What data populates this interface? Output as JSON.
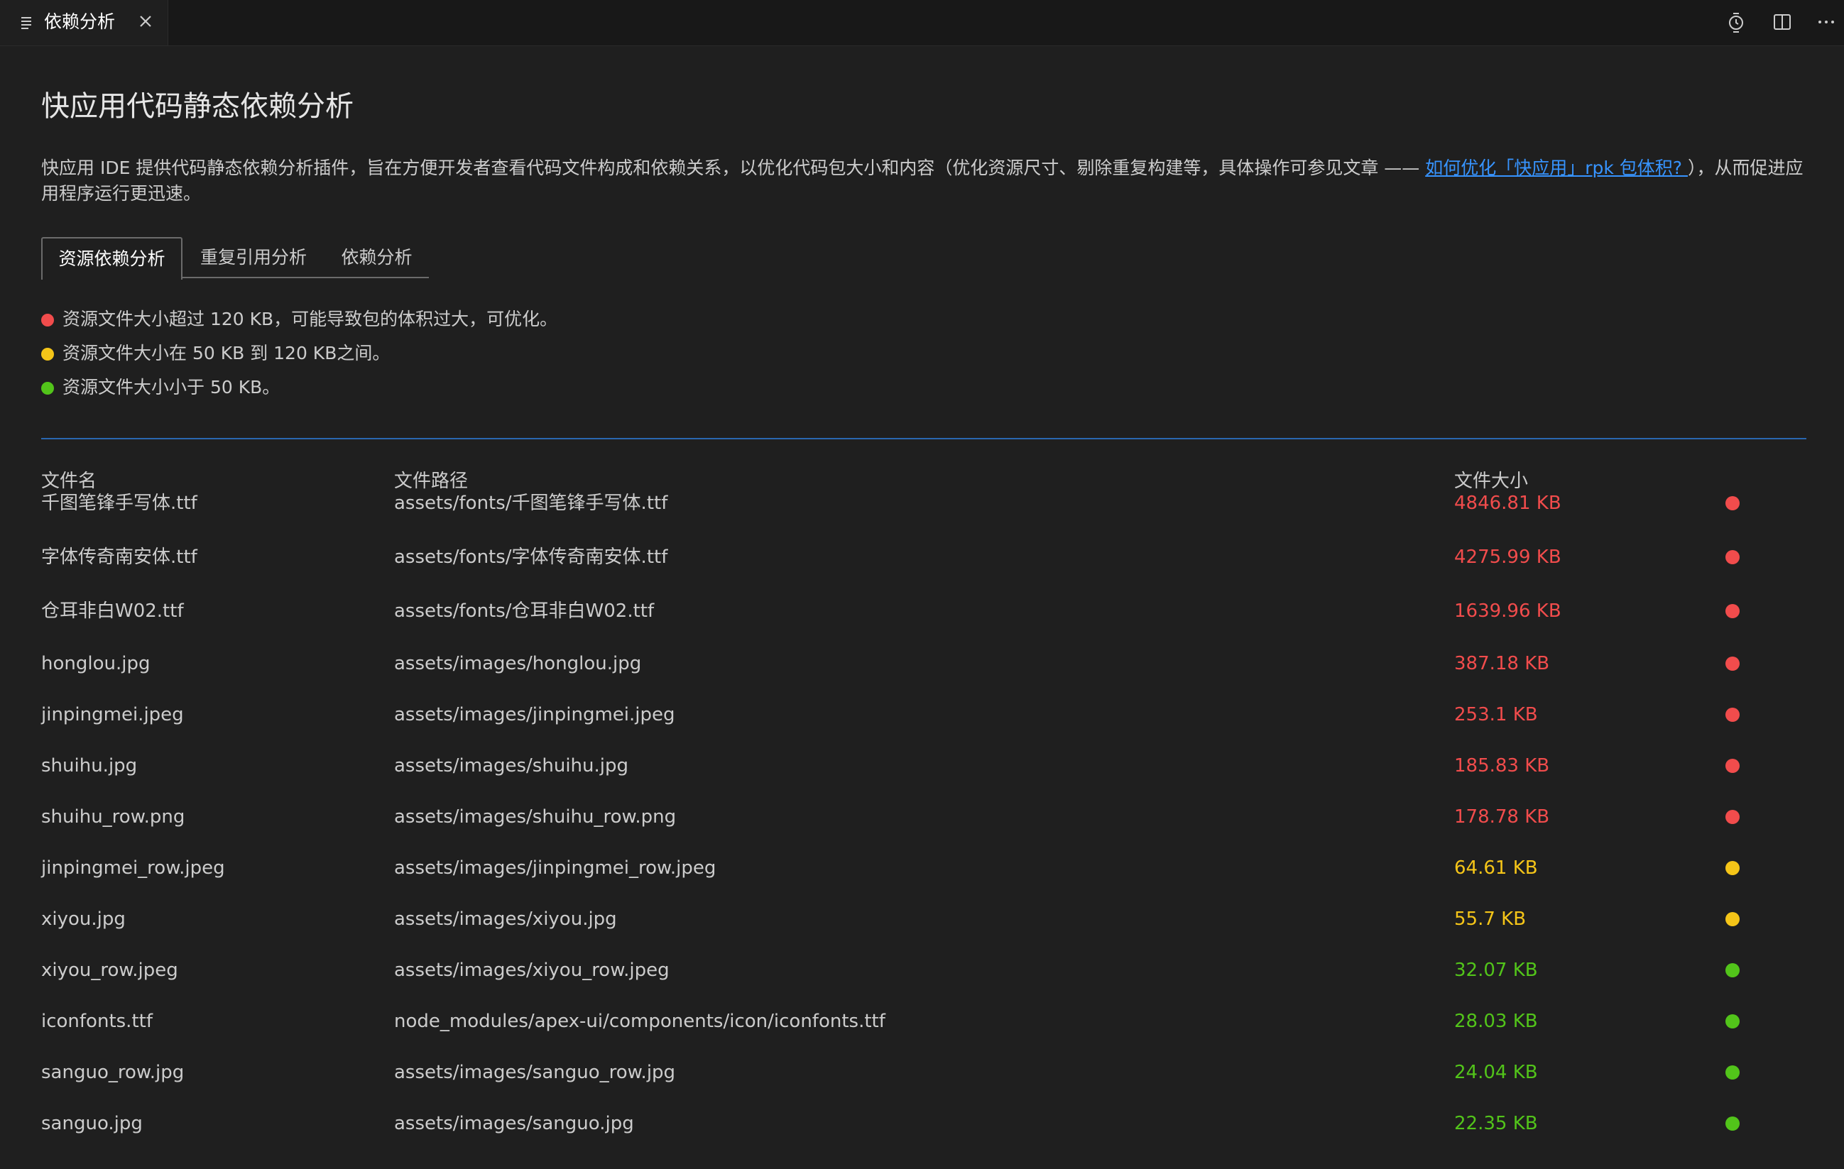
{
  "tab": {
    "title": "依赖分析"
  },
  "icons": {
    "tab": "list-icon",
    "close": "close-icon",
    "timeline": "timeline-icon",
    "split": "split-editor-icon",
    "more": "more-icon"
  },
  "colors": {
    "red": "#f14c4c",
    "yellow": "#f5c518",
    "green": "#52c41a",
    "link": "#3794ff",
    "red_text": "#f14c4c",
    "yellow_text": "#f5c518",
    "green_text": "#52c41a"
  },
  "page": {
    "title": "快应用代码静态依赖分析",
    "intro_text": "快应用 IDE 提供代码静态依赖分析插件，旨在方便开发者查看代码文件构成和依赖关系，以优化代码包大小和内容（优化资源尺寸、剔除重复构建等，具体操作可参见文章 —— ",
    "intro_link": "如何优化「快应用」rpk 包体积? ",
    "intro_tail": "），从而促进应用程序运行更迅速。"
  },
  "tabs": [
    "资源依赖分析",
    "重复引用分析",
    "依赖分析"
  ],
  "legend": [
    {
      "color": "red",
      "text": "资源文件大小超过 120 KB，可能导致包的体积过大，可优化。"
    },
    {
      "color": "yellow",
      "text": "资源文件大小在 50 KB 到 120 KB之间。"
    },
    {
      "color": "green",
      "text": "资源文件大小小于 50 KB。"
    }
  ],
  "table": {
    "headers": [
      "文件名",
      "文件路径",
      "文件大小"
    ],
    "rows": [
      {
        "name": "千图笔锋手写体.ttf",
        "path": "assets/fonts/千图笔锋手写体.ttf",
        "size": "4846.81 KB",
        "level": "red"
      },
      {
        "name": "字体传奇南安体.ttf",
        "path": "assets/fonts/字体传奇南安体.ttf",
        "size": "4275.99 KB",
        "level": "red"
      },
      {
        "name": "仓耳非白W02.ttf",
        "path": "assets/fonts/仓耳非白W02.ttf",
        "size": "1639.96 KB",
        "level": "red"
      },
      {
        "name": "honglou.jpg",
        "path": "assets/images/honglou.jpg",
        "size": "387.18 KB",
        "level": "red"
      },
      {
        "name": "jinpingmei.jpeg",
        "path": "assets/images/jinpingmei.jpeg",
        "size": "253.1 KB",
        "level": "red"
      },
      {
        "name": "shuihu.jpg",
        "path": "assets/images/shuihu.jpg",
        "size": "185.83 KB",
        "level": "red"
      },
      {
        "name": "shuihu_row.png",
        "path": "assets/images/shuihu_row.png",
        "size": "178.78 KB",
        "level": "red"
      },
      {
        "name": "jinpingmei_row.jpeg",
        "path": "assets/images/jinpingmei_row.jpeg",
        "size": "64.61 KB",
        "level": "yellow"
      },
      {
        "name": "xiyou.jpg",
        "path": "assets/images/xiyou.jpg",
        "size": "55.7 KB",
        "level": "yellow"
      },
      {
        "name": "xiyou_row.jpeg",
        "path": "assets/images/xiyou_row.jpeg",
        "size": "32.07 KB",
        "level": "green"
      },
      {
        "name": "iconfonts.ttf",
        "path": "node_modules/apex-ui/components/icon/iconfonts.ttf",
        "size": "28.03 KB",
        "level": "green"
      },
      {
        "name": "sanguo_row.jpg",
        "path": "assets/images/sanguo_row.jpg",
        "size": "24.04 KB",
        "level": "green"
      },
      {
        "name": "sanguo.jpg",
        "path": "assets/images/sanguo.jpg",
        "size": "22.35 KB",
        "level": "green"
      }
    ]
  }
}
